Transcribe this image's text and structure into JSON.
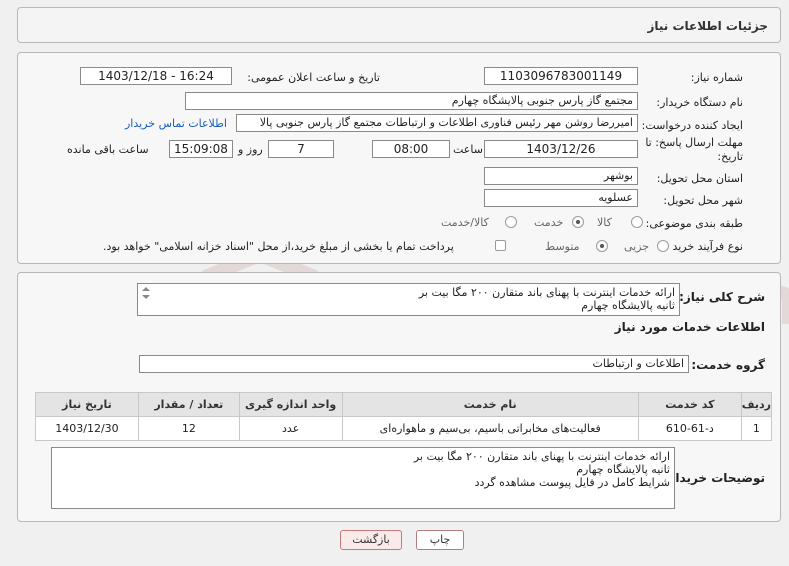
{
  "header": {
    "title": "جزئیات اطلاعات نیاز"
  },
  "form": {
    "need_number_label": "شماره نیاز:",
    "need_number": "1103096783001149",
    "announce_label": "تاریخ و ساعت اعلان عمومی:",
    "announce_value": "1403/12/18 - 16:24",
    "buyer_org_label": "نام دستگاه خریدار:",
    "buyer_org": "مجتمع گاز پارس جنوبی  پالایشگاه چهارم",
    "creator_label": "ایجاد کننده درخواست:",
    "creator": "امیررضا روشن مهر رئیس فناوری اطلاعات و ارتباطات مجتمع گاز پارس جنوبی  پالا",
    "contact_link": "اطلاعات تماس خریدار",
    "deadline_label_1": "مهلت ارسال پاسخ: تا",
    "deadline_label_2": "تاریخ:",
    "deadline_date": "1403/12/26",
    "time_label": "ساعت",
    "deadline_time": "08:00",
    "days_value": "7",
    "days_label": "روز و",
    "remaining_time": "15:09:08",
    "remaining_label": "ساعت باقی مانده",
    "province_label": "استان محل تحویل:",
    "province": "بوشهر",
    "city_label": "شهر محل تحویل:",
    "city": "عسلویه",
    "category_label": "طبقه بندی موضوعی:",
    "category_options": [
      "کالا",
      "خدمت",
      "کالا/خدمت"
    ],
    "category_selected": "خدمت",
    "process_label": "نوع فرآیند خرید :",
    "process_options": [
      "جزیی",
      "متوسط"
    ],
    "process_selected": "متوسط",
    "payment_note": "پرداخت تمام یا بخشی از مبلغ خرید،از محل \"اسناد خزانه اسلامی\" خواهد بود."
  },
  "detail": {
    "summary_label": "شرح کلی نیاز:",
    "summary_text": "ارائه خدمات اینترنت با پهنای باند متقارن ۲۰۰ مگا بیت بر\nثانیه پالایشگاه چهارم",
    "services_heading": "اطلاعات خدمات مورد نیاز",
    "service_group_label": "گروه خدمت:",
    "service_group": "اطلاعات و ارتباطات",
    "table": {
      "headers": [
        "ردیف",
        "کد خدمت",
        "نام خدمت",
        "واحد اندازه گیری",
        "تعداد / مقدار",
        "تاریخ نیاز"
      ],
      "rows": [
        [
          "1",
          "د-61-610",
          "فعالیت‌های مخابراتی باسیم، بی‌سیم و ماهواره‌ای",
          "عدد",
          "12",
          "1403/12/30"
        ]
      ]
    },
    "buyer_notes_label": "توضیحات خریدار:",
    "buyer_notes": "ارائه خدمات اینترنت با پهنای باند متقارن ۲۰۰ مگا بیت بر\nثانیه پالایشگاه چهارم\nشرایط کامل در فایل پیوست مشاهده گردد"
  },
  "buttons": {
    "print": "چاپ",
    "back": "بازگشت"
  },
  "watermark": {
    "text": "AriaTender.neT"
  }
}
